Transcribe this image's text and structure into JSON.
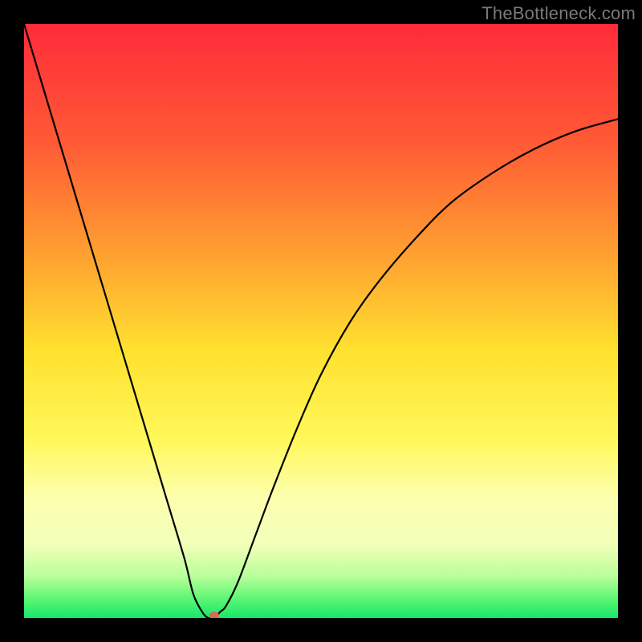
{
  "watermark": "TheBottleneck.com",
  "chart_data": {
    "type": "line",
    "title": "",
    "xlabel": "",
    "ylabel": "",
    "xlim": [
      0,
      100
    ],
    "ylim": [
      0,
      100
    ],
    "background_gradient": {
      "stops": [
        {
          "offset": 0,
          "color": "#ff2b3a"
        },
        {
          "offset": 20,
          "color": "#ff5a35"
        },
        {
          "offset": 40,
          "color": "#ffa531"
        },
        {
          "offset": 55,
          "color": "#ffe12f"
        },
        {
          "offset": 70,
          "color": "#fff85a"
        },
        {
          "offset": 80,
          "color": "#fcffb0"
        },
        {
          "offset": 88,
          "color": "#f0ffb8"
        },
        {
          "offset": 93,
          "color": "#b8ff9a"
        },
        {
          "offset": 97,
          "color": "#57f571"
        },
        {
          "offset": 100,
          "color": "#17e86a"
        }
      ]
    },
    "series": [
      {
        "name": "bottleneck-curve",
        "x": [
          0,
          3,
          6,
          9,
          12,
          15,
          18,
          21,
          24,
          27,
          28.5,
          30,
          31,
          32,
          33,
          34,
          36,
          39,
          42,
          46,
          50,
          55,
          60,
          66,
          72,
          79,
          86,
          93,
          100
        ],
        "y": [
          100,
          90,
          80,
          70,
          60,
          50,
          40,
          30,
          20,
          10,
          4,
          1,
          0,
          0,
          1,
          2,
          6,
          14,
          22,
          32,
          41,
          50,
          57,
          64,
          70,
          75,
          79,
          82,
          84
        ]
      }
    ],
    "marker": {
      "x": 32,
      "y": 0,
      "color": "#d86a5a",
      "rx": 6,
      "ry": 5
    },
    "line_style": {
      "stroke": "#000000",
      "width": 2.2
    }
  }
}
